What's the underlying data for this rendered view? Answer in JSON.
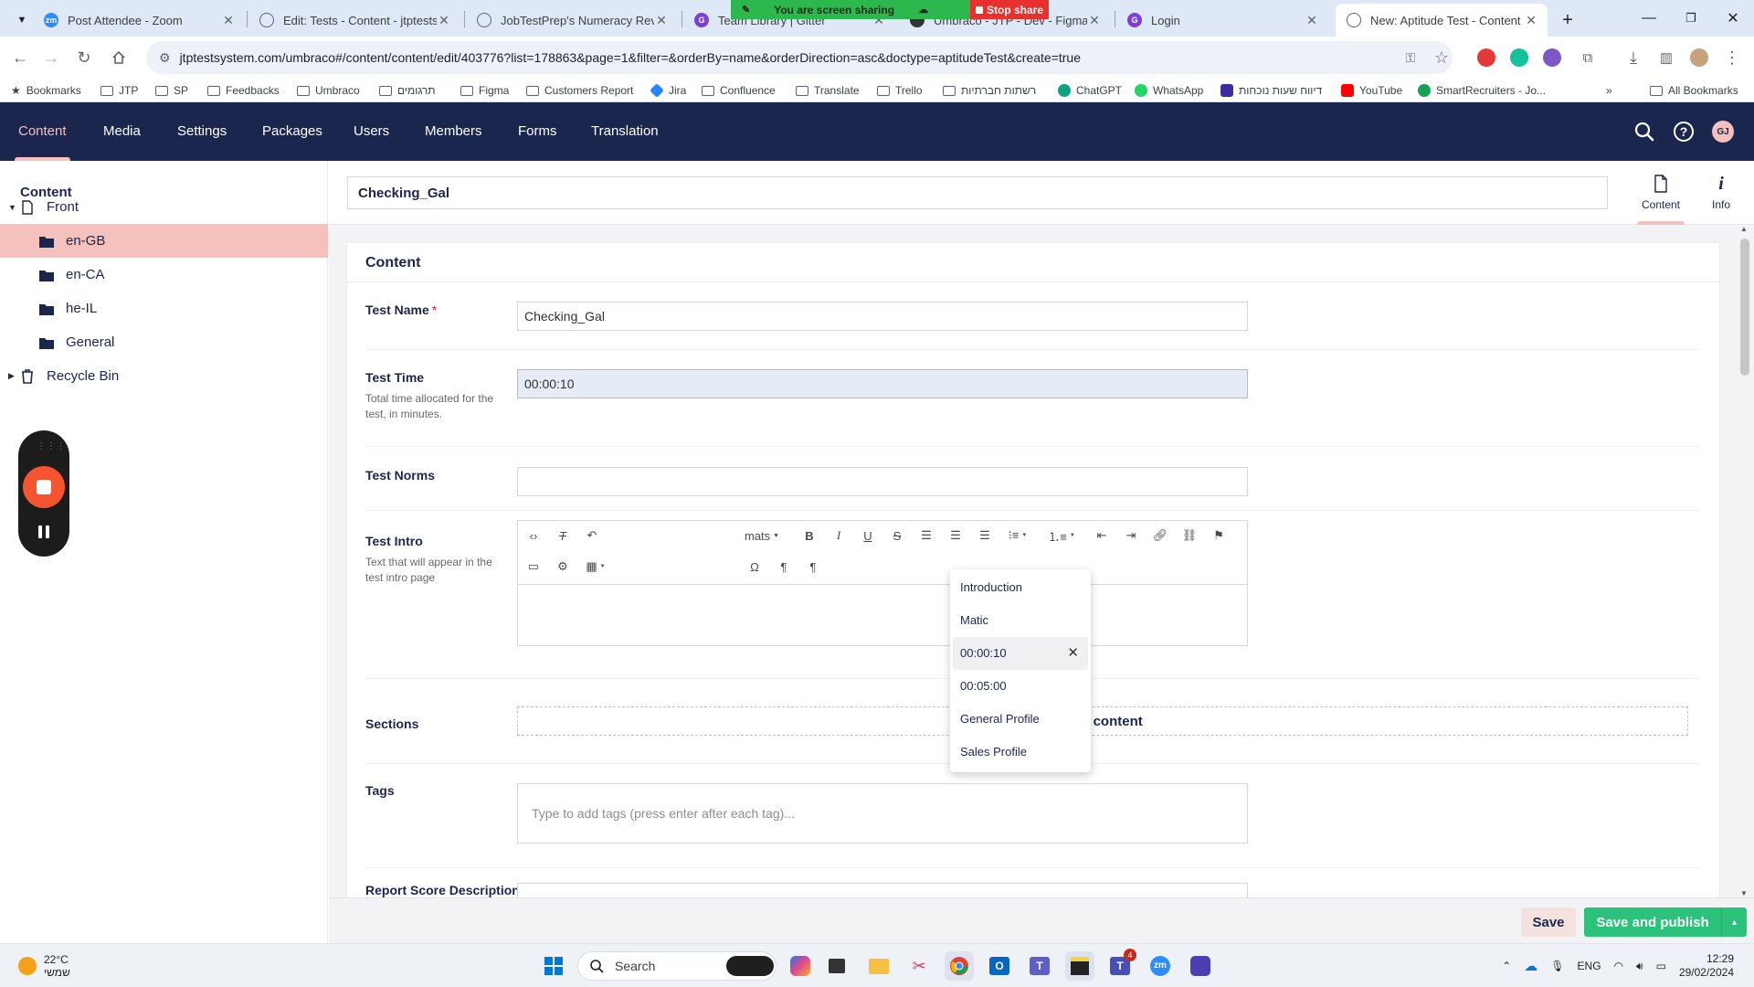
{
  "browser": {
    "tabs": [
      {
        "title": "Post Attendee - Zoom",
        "icon": "zoom-icon",
        "color": "#2d8cff"
      },
      {
        "title": "Edit: Tests - Content - jtptestsys",
        "icon": "globe-icon",
        "color": "#5f6368"
      },
      {
        "title": "JobTestPrep's Numeracy Review",
        "icon": "globe-icon",
        "color": "#5f6368"
      },
      {
        "title": "Team Library | Gitter",
        "icon": "g-icon",
        "color": "#7b3fd6"
      },
      {
        "title": "Umbraco - JTP - Dev - Figma",
        "icon": "figma-icon",
        "color": "#333333"
      },
      {
        "title": "Login",
        "icon": "g-icon",
        "color": "#7b3fd6"
      },
      {
        "title": "New: Aptitude Test - Content -",
        "icon": "globe-icon",
        "color": "#5f6368"
      }
    ],
    "screen_share": {
      "label": "You are screen sharing",
      "stop_label": "Stop share"
    },
    "url": "jtptestsystem.com/umbraco#/content/content/edit/40377​6?list=178863&page=1&filter=&orderBy=name&orderDirection=asc&doctype=aptitudeTest&create=true",
    "bookmarks": [
      "Bookmarks",
      "JTP",
      "SP",
      "Feedbacks",
      "Umbraco",
      "תרגומים",
      "Figma",
      "Customers Report",
      "Jira",
      "Confluence",
      "Translate",
      "Trello",
      "רשתות חברתיות",
      "ChatGPT",
      "WhatsApp",
      "דיווח שעות נוכחות",
      "YouTube",
      "SmartRecruiters - Jo...",
      "All Bookmarks"
    ]
  },
  "header": {
    "sections": [
      "Content",
      "Media",
      "Settings",
      "Packages",
      "Users",
      "Members",
      "Forms",
      "Translation"
    ],
    "active_section": "Content",
    "avatar_initials": "GJ"
  },
  "tree": {
    "title": "Content",
    "nodes": [
      "Front",
      "en-GB",
      "en-CA",
      "he-IL",
      "General",
      "Recycle Bin"
    ]
  },
  "editor": {
    "name": "Checking_Gal",
    "apps": [
      "Content",
      "Info"
    ],
    "group_title": "Content",
    "test_name": {
      "label": "Test Name",
      "required": "*",
      "value": "Checking_Gal"
    },
    "test_time": {
      "label": "Test Time",
      "description": "Total time allocated for the test, in minutes.",
      "value": "00:00:10"
    },
    "test_norms": {
      "label": "Test Norms"
    },
    "test_intro": {
      "label": "Test Intro",
      "description": "Text that will appear in the test intro page",
      "formats_label": "mats"
    },
    "sections": {
      "label": "Sections",
      "add_label": "Add content"
    },
    "tags": {
      "label": "Tags",
      "placeholder": "Type to add tags (press enter after each tag)..."
    },
    "report_score": {
      "label": "Report Score Description"
    },
    "dropdown": [
      "Introduction",
      "Matic",
      "00:00:10",
      "00:05:00",
      "General Profile",
      "Sales Profile"
    ],
    "save_label": "Save",
    "publish_label": "Save and publish"
  },
  "taskbar": {
    "weather_temp": "22°C",
    "weather_desc": "שמשי",
    "search_label": "Search",
    "lang": "ENG",
    "time": "12:29",
    "date": "29/02/2024",
    "teams_badge": "4"
  },
  "colors": {
    "umbraco_navy": "#1b264f",
    "umbraco_pink": "#f5c1bc",
    "publish_green": "#2bc37c",
    "share_green": "#2db84d",
    "share_red": "#e8312f"
  }
}
